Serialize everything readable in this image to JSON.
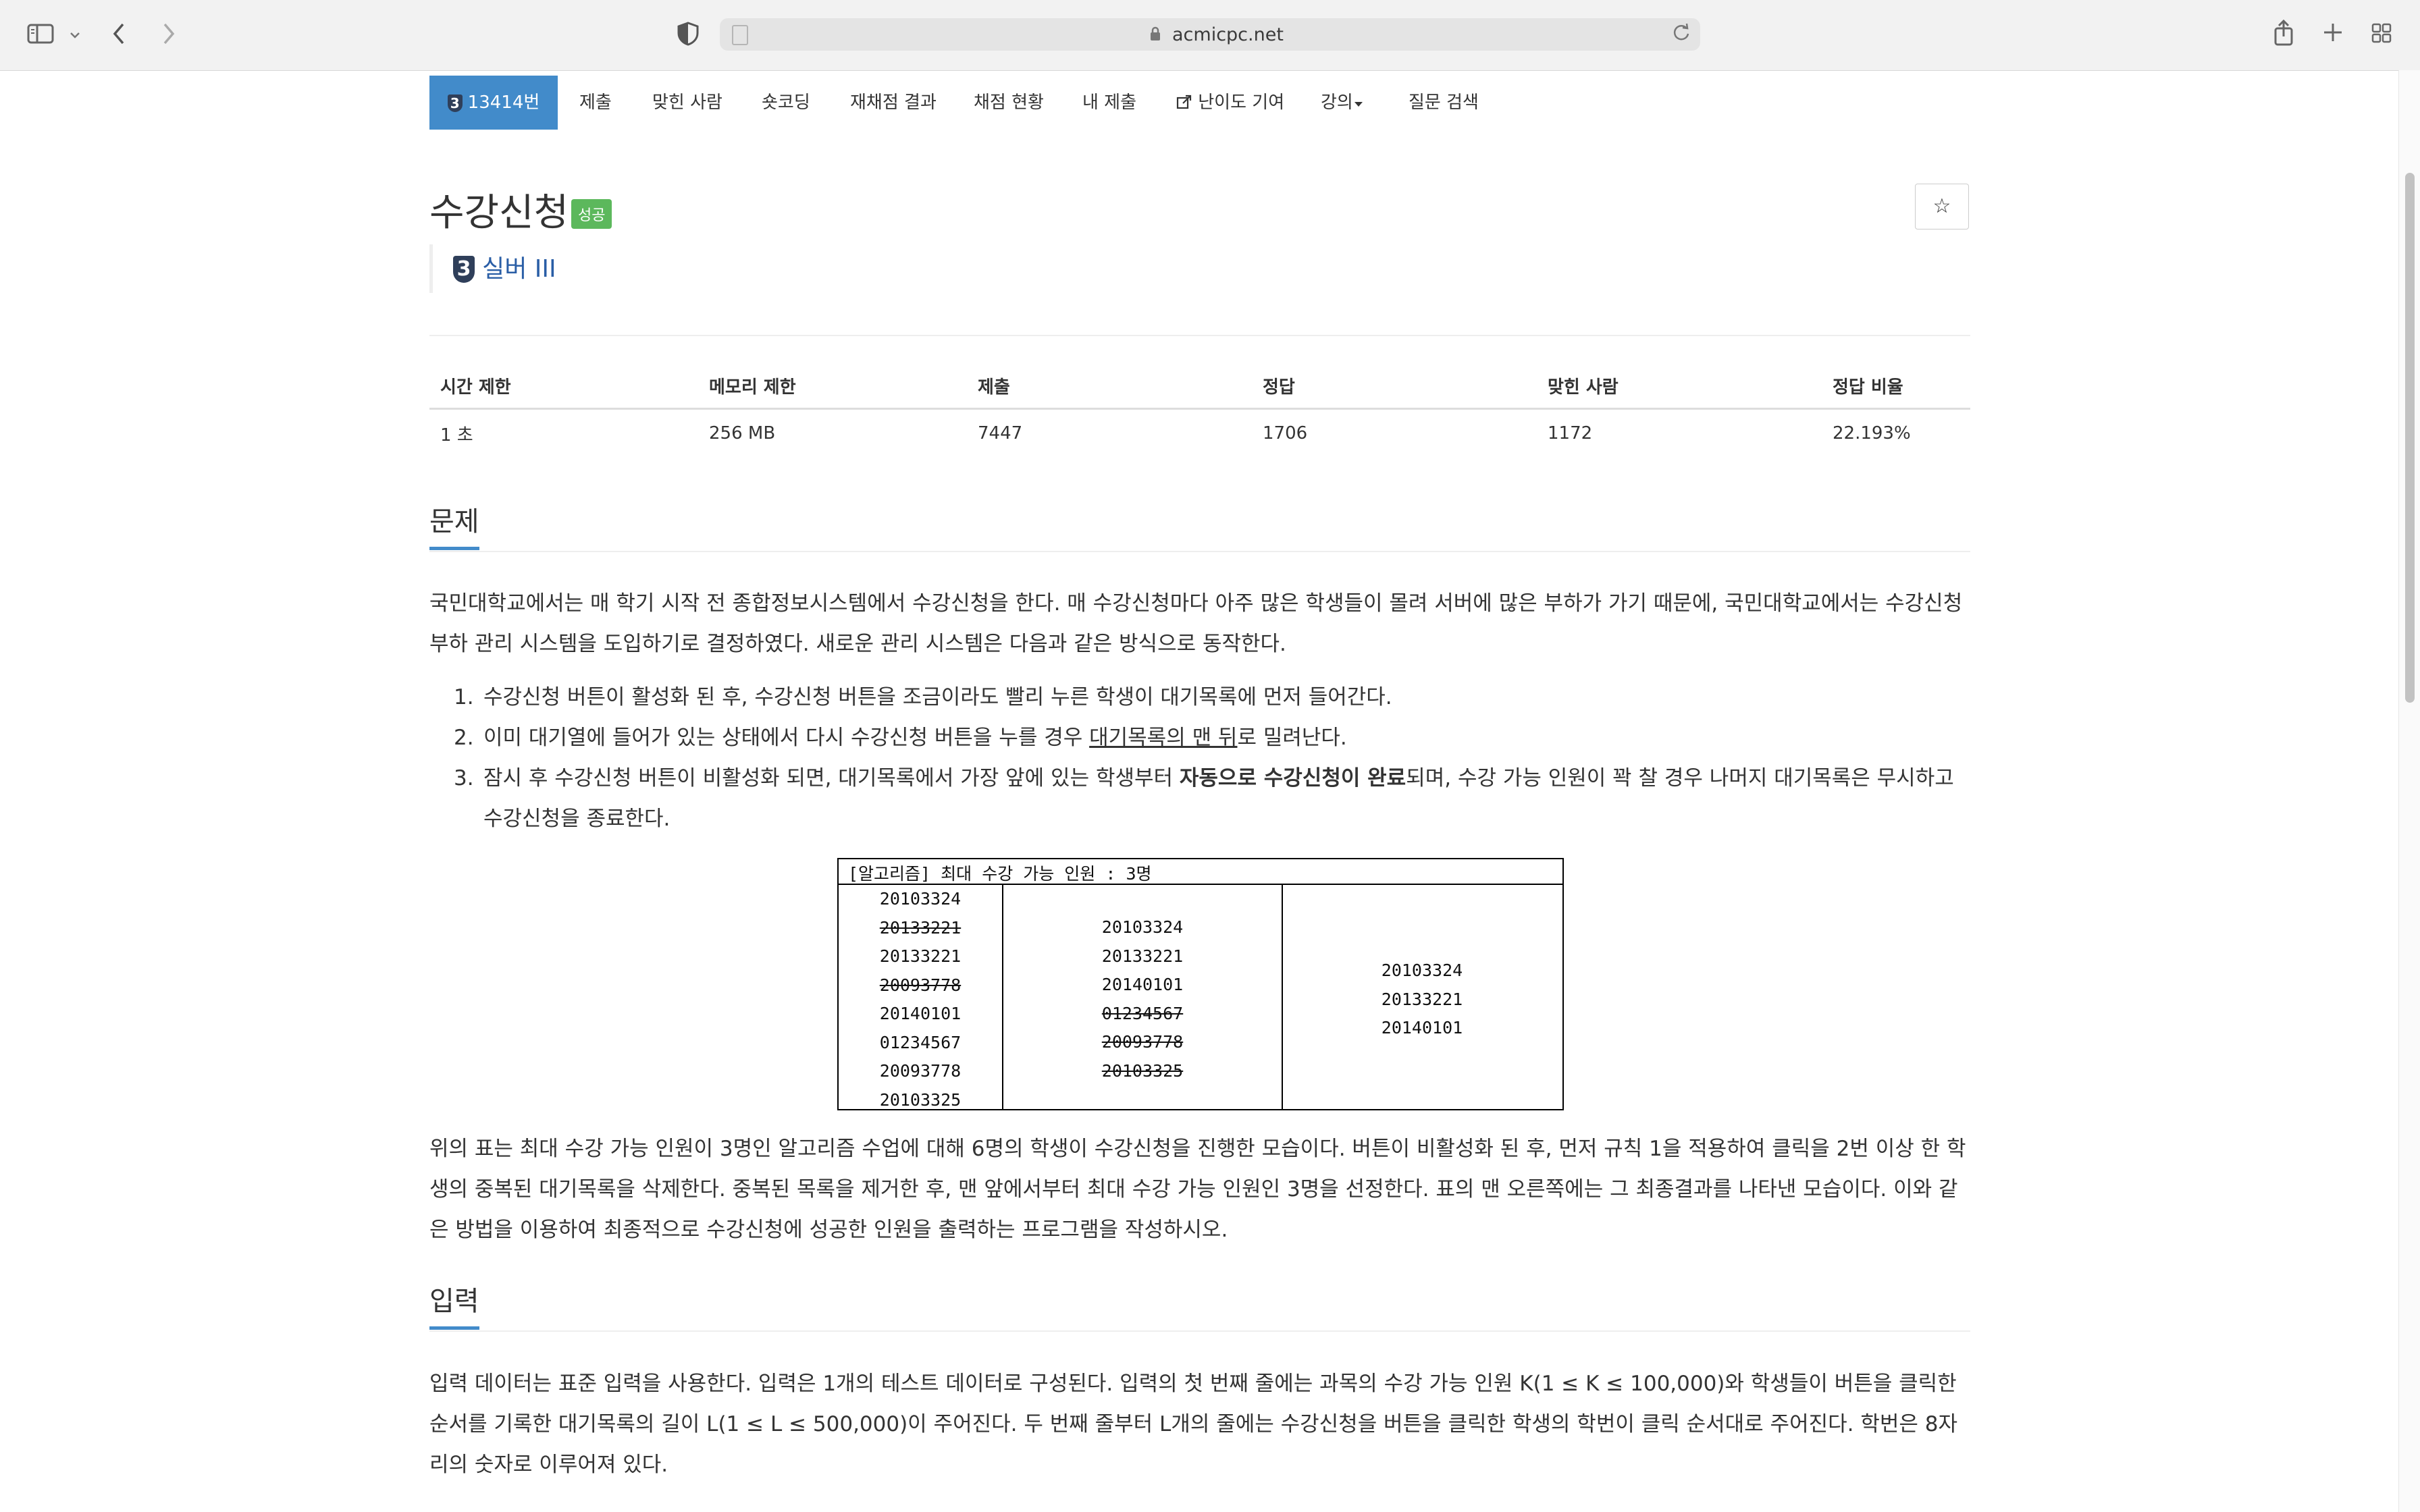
{
  "browser": {
    "url": "acmicpc.net",
    "icons": [
      "sidebar-icon",
      "chevron-down-icon",
      "back-icon",
      "forward-icon",
      "shield-icon",
      "lock-icon",
      "reload-icon",
      "share-icon",
      "new-tab-icon",
      "tab-overview-icon"
    ]
  },
  "menu": {
    "items": [
      {
        "label": "13414번",
        "badge": "3"
      },
      {
        "label": "제출"
      },
      {
        "label": "맞힌 사람"
      },
      {
        "label": "숏코딩"
      },
      {
        "label": "재채점 결과"
      },
      {
        "label": "채점 현황"
      },
      {
        "label": "내 제출"
      },
      {
        "label": "난이도 기여"
      },
      {
        "label": "강의"
      },
      {
        "label": "질문 검색"
      }
    ]
  },
  "problem": {
    "title": "수강신청",
    "status": "성공",
    "tier_badge": "3",
    "tier": "실버 III",
    "star": "☆"
  },
  "stats": {
    "headers": [
      "시간 제한",
      "메모리 제한",
      "제출",
      "정답",
      "맞힌 사람",
      "정답 비율"
    ],
    "values": [
      "1 초",
      "256 MB",
      "7447",
      "1706",
      "1172",
      "22.193%"
    ]
  },
  "section_problem": {
    "heading": "문제",
    "intro": "국민대학교에서는 매 학기 시작 전 종합정보시스템에서 수강신청을 한다. 매 수강신청마다 아주 많은 학생들이 몰려 서버에 많은 부하가 가기 때문에, 국민대학교에서는 수강신청 부하 관리 시스템을 도입하기로 결정하였다. 새로운 관리 시스템은 다음과 같은 방식으로 동작한다.",
    "rules": [
      {
        "num": "1.",
        "text": "수강신청 버튼이 활성화 된 후, 수강신청 버튼을 조금이라도 빨리 누른 학생이 대기목록에 먼저 들어간다."
      },
      {
        "num": "2.",
        "pre": "이미 대기열에 들어가 있는 상태에서 다시 수강신청 버튼을 누를 경우 ",
        "underline": "대기목록의 맨 뒤",
        "post": "로 밀려난다."
      },
      {
        "num": "3.",
        "pre": "잠시 후 수강신청 버튼이 비활성화 되면, 대기목록에서 가장 앞에 있는 학생부터 ",
        "bold": "자동으로 수강신청이 완료",
        "post": "되며, 수강 가능 인원이 꽉 찰 경우 나머지 대기목록은 무시하고 수강신청을 종료한다."
      }
    ],
    "figure": {
      "caption": "[알고리즘] 최대 수강 가능 인원 : 3명",
      "col1": [
        {
          "id": "20103324",
          "struck": false
        },
        {
          "id": "20133221",
          "struck": true
        },
        {
          "id": "20133221",
          "struck": false
        },
        {
          "id": "20093778",
          "struck": true
        },
        {
          "id": "20140101",
          "struck": false
        },
        {
          "id": "01234567",
          "struck": false
        },
        {
          "id": "20093778",
          "struck": false
        },
        {
          "id": "20103325",
          "struck": false
        }
      ],
      "col2": [
        {
          "id": "20103324",
          "struck": false
        },
        {
          "id": "20133221",
          "struck": false
        },
        {
          "id": "20140101",
          "struck": false
        },
        {
          "id": "01234567",
          "struck": true
        },
        {
          "id": "20093778",
          "struck": true
        },
        {
          "id": "20103325",
          "struck": true
        }
      ],
      "col3": [
        {
          "id": "20103324",
          "struck": false
        },
        {
          "id": "20133221",
          "struck": false
        },
        {
          "id": "20140101",
          "struck": false
        }
      ]
    },
    "explanation": "위의 표는 최대 수강 가능 인원이 3명인 알고리즘 수업에 대해 6명의 학생이 수강신청을 진행한 모습이다. 버튼이 비활성화 된 후, 먼저 규칙 1을 적용하여 클릭을 2번 이상 한 학생의 중복된 대기목록을 삭제한다. 중복된 목록을 제거한 후, 맨 앞에서부터 최대 수강 가능 인원인 3명을 선정한다. 표의 맨 오른쪽에는 그 최종결과를 나타낸 모습이다. 이와 같은 방법을 이용하여 최종적으로 수강신청에 성공한 인원을 출력하는 프로그램을 작성하시오."
  },
  "section_input": {
    "heading": "입력",
    "text": "입력 데이터는 표준 입력을 사용한다. 입력은 1개의 테스트 데이터로 구성된다. 입력의 첫 번째 줄에는 과목의 수강 가능 인원 K(1 ≤ K ≤ 100,000)와 학생들이 버튼을 클릭한 순서를 기록한 대기목록의 길이 L(1 ≤ L ≤ 500,000)이 주어진다. 두 번째 줄부터 L개의 줄에는 수강신청을 버튼을 클릭한 학생의 학번이 클릭 순서대로 주어진다. 학번은 8자리의 숫자로 이루어져 있다."
  }
}
